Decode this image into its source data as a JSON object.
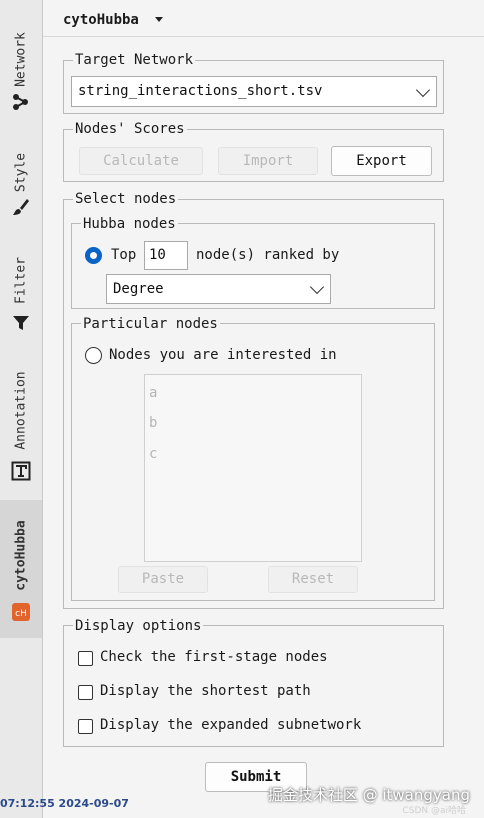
{
  "side_tabs": [
    {
      "label": "Network",
      "icon": "network-icon"
    },
    {
      "label": "Style",
      "icon": "brush-icon"
    },
    {
      "label": "Filter",
      "icon": "filter-icon"
    },
    {
      "label": "Annotation",
      "icon": "annotation-icon"
    },
    {
      "label": "cytoHubba",
      "icon": "cytohubba-icon",
      "active": true
    }
  ],
  "header": {
    "title": "cytoHubba"
  },
  "target_network": {
    "label": "Target Network",
    "selected": "string_interactions_short.tsv"
  },
  "nodes_scores": {
    "label": "Nodes' Scores",
    "calculate": "Calculate",
    "import": "Import",
    "export": "Export"
  },
  "select_nodes": {
    "label": "Select nodes",
    "hubba": {
      "label": "Hubba nodes",
      "top_label": "Top",
      "top_value": "10",
      "ranked_label": "node(s) ranked by",
      "method": "Degree"
    },
    "particular": {
      "label": "Particular nodes",
      "radio_label": "Nodes you are interested in",
      "items": [
        "a",
        "b",
        "c"
      ],
      "paste": "Paste",
      "reset": "Reset"
    }
  },
  "display_options": {
    "label": "Display options",
    "options": [
      "Check the first-stage nodes",
      "Display the shortest path",
      "Display the expanded subnetwork"
    ]
  },
  "submit": "Submit",
  "status_time": "07:12:55 2024-09-07",
  "watermark": "掘金技术社区 @ itwangyang",
  "watermark_small": "CSDN @ai哈哈"
}
